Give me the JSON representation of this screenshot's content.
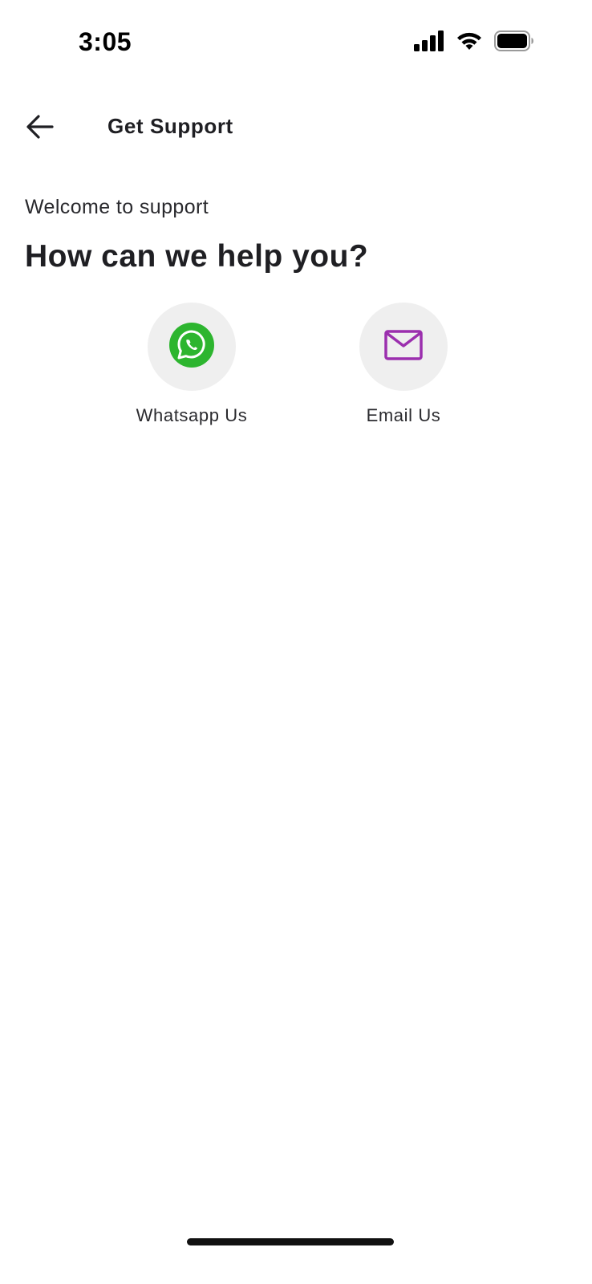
{
  "status_bar": {
    "time": "3:05",
    "signal_icon": "cellular-signal-icon",
    "wifi_icon": "wifi-icon",
    "battery_icon": "battery-icon"
  },
  "header": {
    "back_icon": "arrow-left-icon",
    "title": "Get Support"
  },
  "intro": {
    "welcome": "Welcome to support",
    "headline": "How can we help you?"
  },
  "options": [
    {
      "label": "Whatsapp Us",
      "icon": "whatsapp-icon",
      "color": "#2db52f"
    },
    {
      "label": "Email Us",
      "icon": "mail-icon",
      "color": "#9b2fae"
    }
  ],
  "colors": {
    "option_circle_bg": "#efefef",
    "text": "#1f1f23"
  }
}
